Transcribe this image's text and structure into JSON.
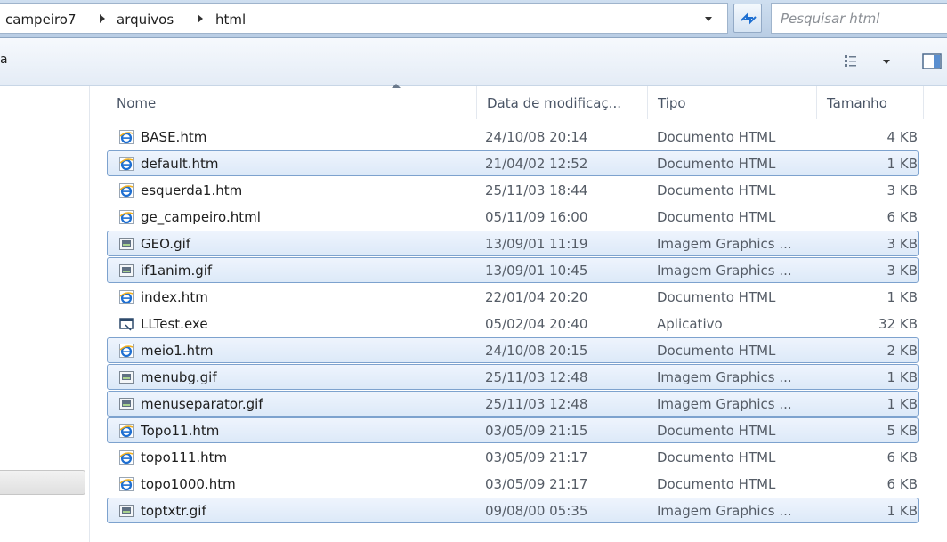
{
  "address": {
    "breadcrumbs": [
      "campeiro7",
      "arquivos",
      "html"
    ],
    "search_placeholder": "Pesquisar html"
  },
  "toolbar": {
    "fragment": "a",
    "views_icon": "views-icon",
    "preview_icon": "preview-pane-icon"
  },
  "columns": {
    "name": "Nome",
    "date": "Data de modificaç...",
    "type": "Tipo",
    "size": "Tamanho",
    "sorted_by": "name"
  },
  "files": [
    {
      "name": "BASE.htm",
      "date": "24/10/08 20:14",
      "type": "Documento HTML",
      "size": "4 KB",
      "icon": "ie-html-icon",
      "selected": false
    },
    {
      "name": "default.htm",
      "date": "21/04/02 12:52",
      "type": "Documento HTML",
      "size": "1 KB",
      "icon": "ie-html-icon",
      "selected": true
    },
    {
      "name": "esquerda1.htm",
      "date": "25/11/03 18:44",
      "type": "Documento HTML",
      "size": "3 KB",
      "icon": "ie-html-icon",
      "selected": false
    },
    {
      "name": "ge_campeiro.html",
      "date": "05/11/09 16:00",
      "type": "Documento HTML",
      "size": "6 KB",
      "icon": "ie-html-icon",
      "selected": false
    },
    {
      "name": "GEO.gif",
      "date": "13/09/01 11:19",
      "type": "Imagem Graphics ...",
      "size": "3 KB",
      "icon": "image-file-icon",
      "selected": true
    },
    {
      "name": "if1anim.gif",
      "date": "13/09/01 10:45",
      "type": "Imagem Graphics ...",
      "size": "3 KB",
      "icon": "image-file-icon",
      "selected": true
    },
    {
      "name": "index.htm",
      "date": "22/01/04 20:20",
      "type": "Documento HTML",
      "size": "1 KB",
      "icon": "ie-html-icon",
      "selected": false
    },
    {
      "name": "LLTest.exe",
      "date": "05/02/04 20:40",
      "type": "Aplicativo",
      "size": "32 KB",
      "icon": "application-icon",
      "selected": false
    },
    {
      "name": "meio1.htm",
      "date": "24/10/08 20:15",
      "type": "Documento HTML",
      "size": "2 KB",
      "icon": "ie-html-icon",
      "selected": true
    },
    {
      "name": "menubg.gif",
      "date": "25/11/03 12:48",
      "type": "Imagem Graphics ...",
      "size": "1 KB",
      "icon": "image-file-icon",
      "selected": true
    },
    {
      "name": "menuseparator.gif",
      "date": "25/11/03 12:48",
      "type": "Imagem Graphics ...",
      "size": "1 KB",
      "icon": "image-file-icon",
      "selected": true
    },
    {
      "name": "Topo11.htm",
      "date": "03/05/09 21:15",
      "type": "Documento HTML",
      "size": "5 KB",
      "icon": "ie-html-icon",
      "selected": true
    },
    {
      "name": "topo111.htm",
      "date": "03/05/09 21:17",
      "type": "Documento HTML",
      "size": "6 KB",
      "icon": "ie-html-icon",
      "selected": false
    },
    {
      "name": "topo1000.htm",
      "date": "03/05/09 21:17",
      "type": "Documento HTML",
      "size": "6 KB",
      "icon": "ie-html-icon",
      "selected": false
    },
    {
      "name": "toptxtr.gif",
      "date": "09/08/00 05:35",
      "type": "Imagem Graphics ...",
      "size": "1 KB",
      "icon": "image-file-icon",
      "selected": true
    }
  ],
  "colors": {
    "selection_border": "#7da2ce",
    "selection_fill": "#dce9f8",
    "ie_icon_blue": "#1e6fd1"
  }
}
